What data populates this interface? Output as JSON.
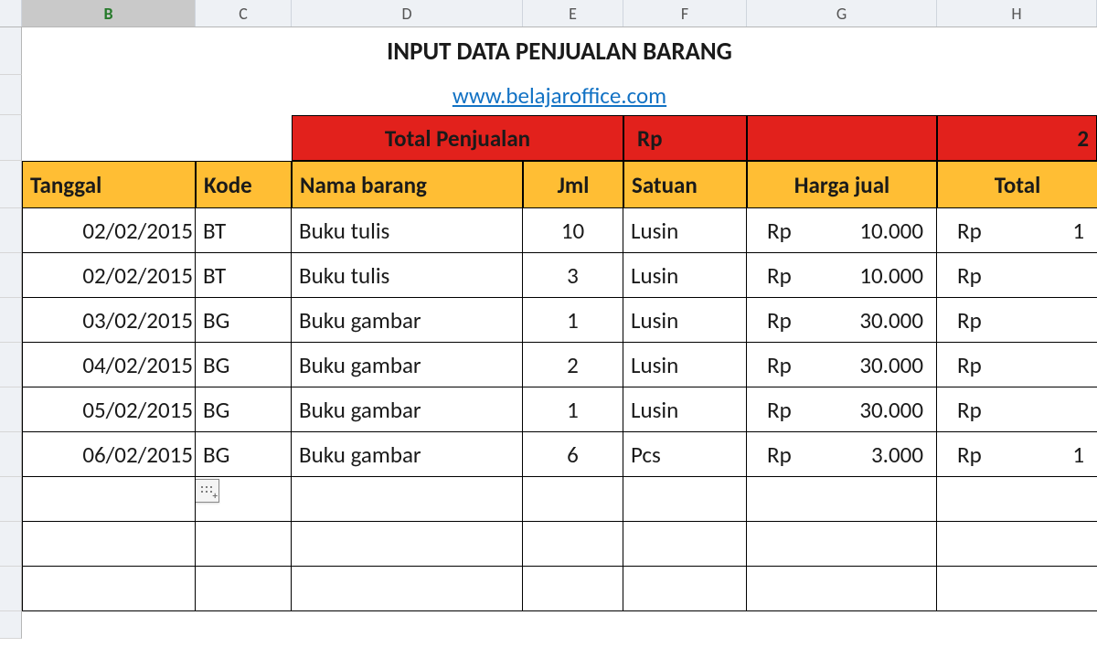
{
  "columns": {
    "B": "B",
    "C": "C",
    "D": "D",
    "E": "E",
    "F": "F",
    "G": "G",
    "H": "H"
  },
  "active_column": "B",
  "title": "INPUT DATA PENJUALAN BARANG",
  "link_text": "www.belajaroffice.com",
  "total_row": {
    "label": "Total Penjualan",
    "currency": "Rp",
    "value_partial": "2"
  },
  "headers": {
    "tanggal": "Tanggal",
    "kode": "Kode",
    "nama": "Nama barang",
    "jml": "Jml",
    "satuan": "Satuan",
    "harga": "Harga jual",
    "total": "Total "
  },
  "rows": [
    {
      "tanggal": "02/02/2015",
      "kode": "BT",
      "nama": "Buku tulis",
      "jml": "10",
      "satuan": "Lusin",
      "harga_cur": "Rp",
      "harga_val": "10.000",
      "tot_cur": "Rp",
      "tot_val": "1"
    },
    {
      "tanggal": "02/02/2015",
      "kode": "BT",
      "nama": "Buku tulis",
      "jml": "3",
      "satuan": "Lusin",
      "harga_cur": "Rp",
      "harga_val": "10.000",
      "tot_cur": "Rp",
      "tot_val": ""
    },
    {
      "tanggal": "03/02/2015",
      "kode": "BG",
      "nama": "Buku gambar",
      "jml": "1",
      "satuan": "Lusin",
      "harga_cur": "Rp",
      "harga_val": "30.000",
      "tot_cur": "Rp",
      "tot_val": ""
    },
    {
      "tanggal": "04/02/2015",
      "kode": "BG",
      "nama": "Buku gambar",
      "jml": "2",
      "satuan": "Lusin",
      "harga_cur": "Rp",
      "harga_val": "30.000",
      "tot_cur": "Rp",
      "tot_val": ""
    },
    {
      "tanggal": "05/02/2015",
      "kode": "BG",
      "nama": "Buku gambar",
      "jml": "1",
      "satuan": "Lusin",
      "harga_cur": "Rp",
      "harga_val": "30.000",
      "tot_cur": "Rp",
      "tot_val": ""
    },
    {
      "tanggal": "06/02/2015",
      "kode": "BG",
      "nama": "Buku gambar",
      "jml": "6",
      "satuan": "Pcs",
      "harga_cur": "Rp",
      "harga_val": "3.000",
      "tot_cur": "Rp",
      "tot_val": "1"
    }
  ]
}
